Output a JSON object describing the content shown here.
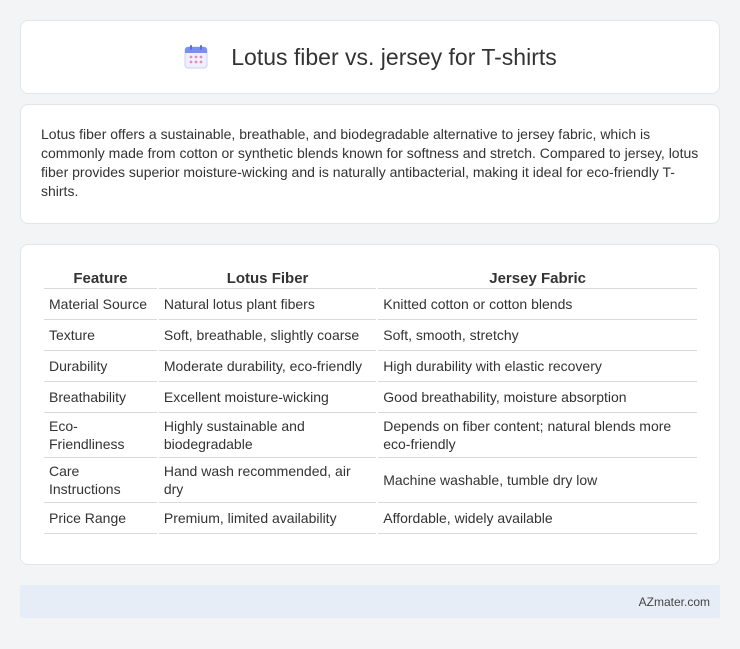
{
  "header": {
    "title": "Lotus fiber vs. jersey for T-shirts",
    "icon": "calendar-icon",
    "icon_colors": {
      "top": "#7b8ff0",
      "body": "#eef0fd",
      "dots": "#e58fb0"
    }
  },
  "intro": {
    "text": "Lotus fiber offers a sustainable, breathable, and biodegradable alternative to jersey fabric, which is commonly made from cotton or synthetic blends known for softness and stretch. Compared to jersey, lotus fiber provides superior moisture-wicking and is naturally antibacterial, making it ideal for eco-friendly T-shirts."
  },
  "table": {
    "headers": [
      "Feature",
      "Lotus Fiber",
      "Jersey Fabric"
    ],
    "rows": [
      [
        "Material Source",
        "Natural lotus plant fibers",
        "Knitted cotton or cotton blends"
      ],
      [
        "Texture",
        "Soft, breathable, slightly coarse",
        "Soft, smooth, stretchy"
      ],
      [
        "Durability",
        "Moderate durability, eco-friendly",
        "High durability with elastic recovery"
      ],
      [
        "Breathability",
        "Excellent moisture-wicking",
        "Good breathability, moisture absorption"
      ],
      [
        "Eco-Friendliness",
        "Highly sustainable and biodegradable",
        "Depends on fiber content; natural blends more eco-friendly"
      ],
      [
        "Care Instructions",
        "Hand wash recommended, air dry",
        "Machine washable, tumble dry low"
      ],
      [
        "Price Range",
        "Premium, limited availability",
        "Affordable, widely available"
      ]
    ]
  },
  "footer": {
    "site": "AZmater.com"
  }
}
